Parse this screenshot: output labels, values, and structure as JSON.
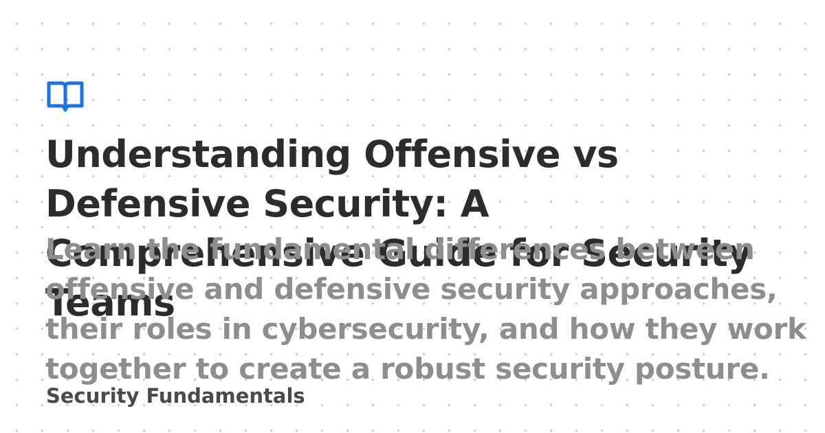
{
  "logo": {
    "icon": "open-book-icon",
    "color": "#1a73e8"
  },
  "post": {
    "title": "Understanding Offensive vs Defensive Security: A Comprehensive Guide for Security Teams",
    "description": "Learn the fundamental differences between offensive and defensive security approaches, their roles in cybersecurity, and how they work together to create a robust security posture.",
    "category": "Security Fundamentals"
  },
  "colors": {
    "background": "#ffffff",
    "dots": "#d2d2d2",
    "title": "#2c2c2c",
    "description": "#8e8e8e",
    "category": "#4a4a4a",
    "accent": "#1a73e8"
  }
}
